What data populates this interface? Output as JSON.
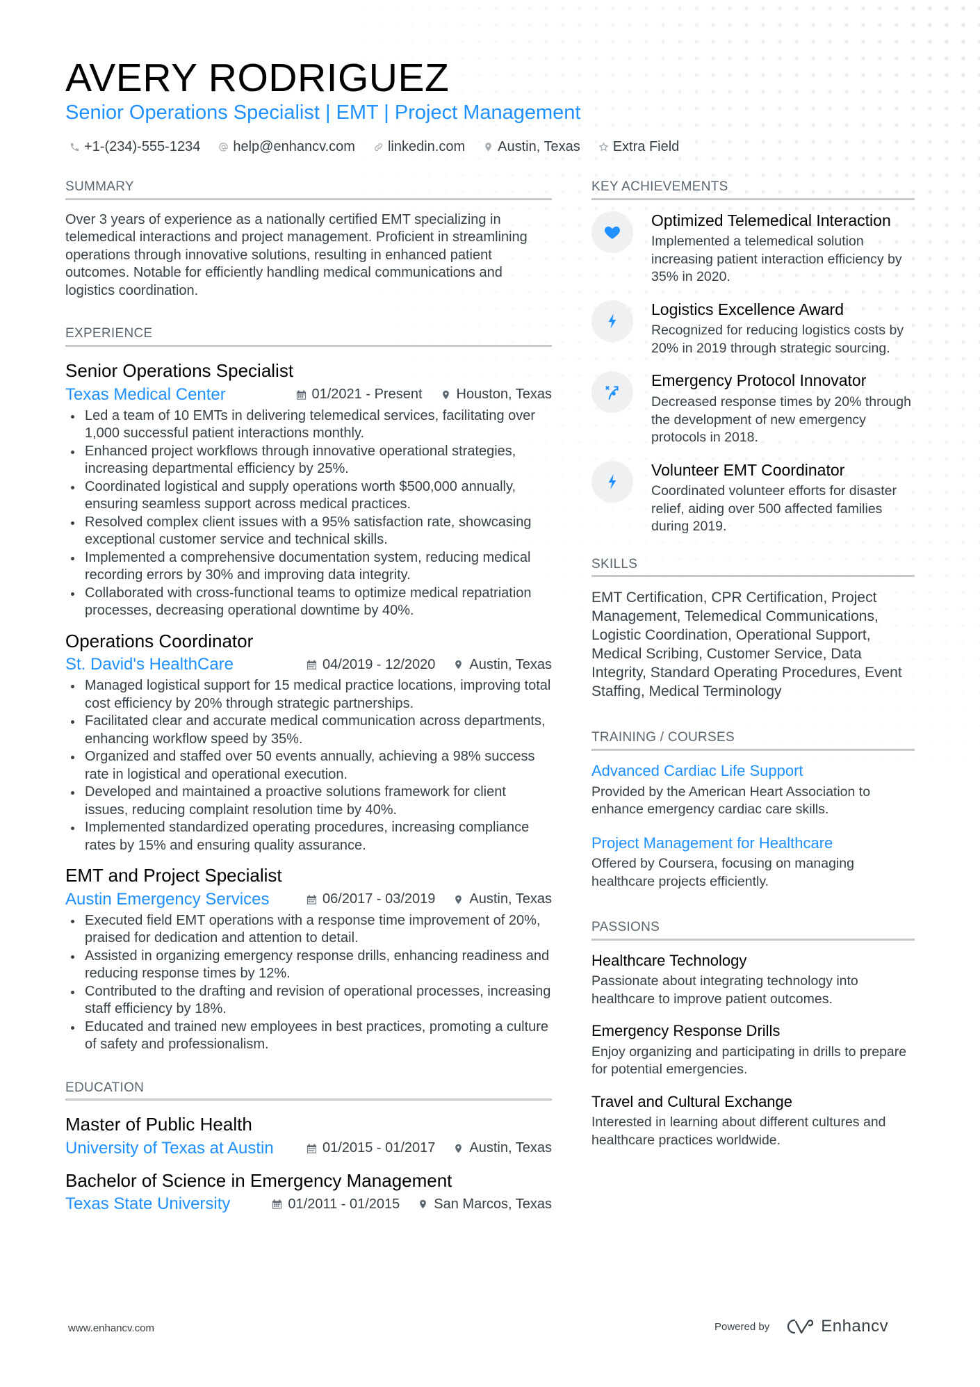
{
  "header": {
    "name": "AVERY RODRIGUEZ",
    "headline": "Senior Operations Specialist | EMT | Project Management",
    "contacts": [
      {
        "icon": "phone-icon",
        "text": "+1-(234)-555-1234"
      },
      {
        "icon": "at-icon",
        "text": "help@enhancv.com"
      },
      {
        "icon": "link-icon",
        "text": "linkedin.com"
      },
      {
        "icon": "location-pin-icon",
        "text": "Austin, Texas"
      },
      {
        "icon": "star-icon",
        "text": "Extra Field"
      }
    ]
  },
  "summary": {
    "title": "SUMMARY",
    "text": "Over 3 years of experience as a nationally certified EMT specializing in telemedical interactions and project management. Proficient in streamlining operations through innovative solutions, resulting in enhanced patient outcomes. Notable for efficiently handling medical communications and logistics coordination."
  },
  "experience": {
    "title": "EXPERIENCE",
    "jobs": [
      {
        "title": "Senior Operations Specialist",
        "company": "Texas Medical Center",
        "dates": "01/2021 - Present",
        "location": "Houston, Texas",
        "bullets": [
          "Led a team of 10 EMTs in delivering telemedical services, facilitating over 1,000 successful patient interactions monthly.",
          "Enhanced project workflows through innovative operational strategies, increasing departmental efficiency by 25%.",
          "Coordinated logistical and supply operations worth $500,000 annually, ensuring seamless support across medical practices.",
          "Resolved complex client issues with a 95% satisfaction rate, showcasing exceptional customer service and technical skills.",
          "Implemented a comprehensive documentation system, reducing medical recording errors by 30% and improving data integrity.",
          "Collaborated with cross-functional teams to optimize medical repatriation processes, decreasing operational downtime by 40%."
        ]
      },
      {
        "title": "Operations Coordinator",
        "company": "St. David's HealthCare",
        "dates": "04/2019 - 12/2020",
        "location": "Austin, Texas",
        "bullets": [
          "Managed logistical support for 15 medical practice locations, improving total cost efficiency by 20% through strategic partnerships.",
          "Facilitated clear and accurate medical communication across departments, enhancing workflow speed by 35%.",
          "Organized and staffed over 50 events annually, achieving a 98% success rate in logistical and operational execution.",
          "Developed and maintained a proactive solutions framework for client issues, reducing complaint resolution time by 40%.",
          "Implemented standardized operating procedures, increasing compliance rates by 15% and ensuring quality assurance."
        ]
      },
      {
        "title": "EMT and Project Specialist",
        "company": "Austin Emergency Services",
        "dates": "06/2017 - 03/2019",
        "location": "Austin, Texas",
        "bullets": [
          "Executed field EMT operations with a response time improvement of 20%, praised for dedication and attention to detail.",
          "Assisted in organizing emergency response drills, enhancing readiness and reducing response times by 12%.",
          "Contributed to the drafting and revision of operational processes, increasing staff efficiency by 18%.",
          "Educated and trained new employees in best practices, promoting a culture of safety and professionalism."
        ]
      }
    ]
  },
  "education": {
    "title": "EDUCATION",
    "items": [
      {
        "degree": "Master of Public Health",
        "school": "University of Texas at Austin",
        "dates": "01/2015 - 01/2017",
        "location": "Austin, Texas"
      },
      {
        "degree": "Bachelor of Science in Emergency Management",
        "school": "Texas State University",
        "dates": "01/2011 - 01/2015",
        "location": "San Marcos, Texas"
      }
    ]
  },
  "achievements": {
    "title": "KEY ACHIEVEMENTS",
    "items": [
      {
        "icon": "heart-icon",
        "title": "Optimized Telemedical Interaction",
        "desc": "Implemented a telemedical solution increasing patient interaction efficiency by 35% in 2020."
      },
      {
        "icon": "lightning-bolt-icon",
        "title": "Logistics Excellence Award",
        "desc": "Recognized for reducing logistics costs by 20% in 2019 through strategic sourcing."
      },
      {
        "icon": "strategy-play-icon",
        "title": "Emergency Protocol Innovator",
        "desc": "Decreased response times by 20% through the development of new emergency protocols in 2018."
      },
      {
        "icon": "lightning-bolt-icon",
        "title": "Volunteer EMT Coordinator",
        "desc": "Coordinated volunteer efforts for disaster relief, aiding over 500 affected families during 2019."
      }
    ]
  },
  "skills": {
    "title": "SKILLS",
    "text": "EMT Certification, CPR Certification, Project Management, Telemedical Communications, Logistic Coordination, Operational Support, Medical Scribing, Customer Service, Data Integrity, Standard Operating Procedures, Event Staffing, Medical Terminology"
  },
  "training": {
    "title": "TRAINING / COURSES",
    "items": [
      {
        "title": "Advanced Cardiac Life Support",
        "desc": "Provided by the American Heart Association to enhance emergency cardiac care skills."
      },
      {
        "title": "Project Management for Healthcare",
        "desc": "Offered by Coursera, focusing on managing healthcare projects efficiently."
      }
    ]
  },
  "passions": {
    "title": "PASSIONS",
    "items": [
      {
        "title": "Healthcare Technology",
        "desc": "Passionate about integrating technology into healthcare to improve patient outcomes."
      },
      {
        "title": "Emergency Response Drills",
        "desc": "Enjoy organizing and participating in drills to prepare for potential emergencies."
      },
      {
        "title": "Travel and Cultural Exchange",
        "desc": "Interested in learning about different cultures and healthcare practices worldwide."
      }
    ]
  },
  "footer": {
    "url": "www.enhancv.com",
    "powered_by": "Powered by",
    "brand": "Enhancv"
  },
  "colors": {
    "accent": "#1e90ff",
    "text": "#384047",
    "heading": "#000000",
    "divider": "#c4c8cc",
    "icon_bg": "#eff0f1"
  }
}
